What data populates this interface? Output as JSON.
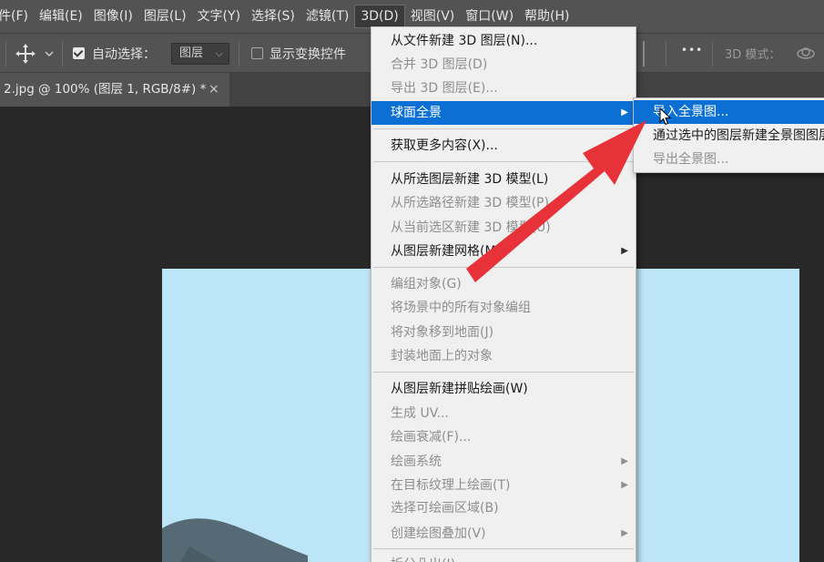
{
  "menubar": {
    "items": [
      "件(F)",
      "编辑(E)",
      "图像(I)",
      "图层(L)",
      "文字(Y)",
      "选择(S)",
      "滤镜(T)",
      "3D(D)",
      "视图(V)",
      "窗口(W)",
      "帮助(H)"
    ]
  },
  "options": {
    "auto_select_label": "自动选择：",
    "auto_select_value": "图层",
    "show_transform_label": "显示变换控件",
    "mode_3d_label": "3D 模式：",
    "more_label": "•••"
  },
  "tab": {
    "title": "2.jpg @ 100% (图层 1, RGB/8#) *",
    "close": "×"
  },
  "menu3d": {
    "items": [
      {
        "label": "从文件新建 3D 图层(N)...",
        "disabled": false
      },
      {
        "label": "合并 3D 图层(D)",
        "disabled": true
      },
      {
        "label": "导出 3D 图层(E)...",
        "disabled": true
      },
      {
        "label": "球面全景",
        "disabled": false,
        "highlighted": true,
        "submenu": true
      },
      {
        "label": "获取更多内容(X)...",
        "disabled": false
      },
      {
        "label": "从所选图层新建 3D 模型(L)",
        "disabled": false
      },
      {
        "label": "从所选路径新建 3D 模型(P)",
        "disabled": true
      },
      {
        "label": "从当前选区新建 3D 模型(U)",
        "disabled": true
      },
      {
        "label": "从图层新建网格(M)",
        "disabled": false,
        "submenu": true
      },
      {
        "label": "编组对象(G)",
        "disabled": true
      },
      {
        "label": "将场景中的所有对象编组",
        "disabled": true
      },
      {
        "label": "将对象移到地面(J)",
        "disabled": true
      },
      {
        "label": "封装地面上的对象",
        "disabled": true
      },
      {
        "label": "从图层新建拼贴绘画(W)",
        "disabled": false
      },
      {
        "label": "生成 UV...",
        "disabled": true
      },
      {
        "label": "绘画衰减(F)...",
        "disabled": true
      },
      {
        "label": "绘画系统",
        "disabled": true,
        "submenu": true
      },
      {
        "label": "在目标纹理上绘画(T)",
        "disabled": true,
        "submenu": true
      },
      {
        "label": "选择可绘画区域(B)",
        "disabled": true
      },
      {
        "label": "创建绘图叠加(V)",
        "disabled": true,
        "submenu": true
      },
      {
        "label": "拆分凸出(I)",
        "disabled": true
      }
    ]
  },
  "submenu": {
    "items": [
      {
        "label": "导入全景图...",
        "highlighted": true
      },
      {
        "label": "通过选中的图层新建全景图图层",
        "disabled": false
      },
      {
        "label": "导出全景图...",
        "disabled": true
      }
    ]
  },
  "colors": {
    "menu_highlight": "#0b6fd4",
    "annotation_arrow": "#e8323a",
    "canvas": "#bce6f7"
  }
}
